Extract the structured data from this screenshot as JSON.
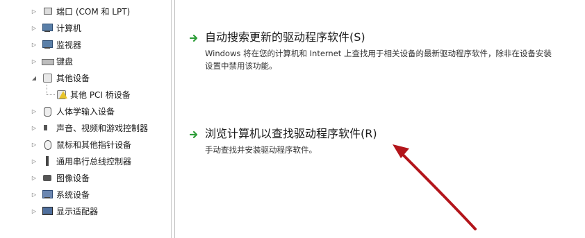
{
  "tree": {
    "items": [
      {
        "label": "端口 (COM 和 LPT)",
        "icon": "port-icon",
        "expander": "▷"
      },
      {
        "label": "计算机",
        "icon": "computer-icon",
        "expander": "▷"
      },
      {
        "label": "监视器",
        "icon": "monitor-icon",
        "expander": "▷"
      },
      {
        "label": "键盘",
        "icon": "keyboard-icon",
        "expander": "▷"
      },
      {
        "label": "其他设备",
        "icon": "other-devices-icon",
        "expander": "◢"
      },
      {
        "label": "其他 PCI 桥设备",
        "icon": "warning-device-icon",
        "expander": ""
      },
      {
        "label": "人体学输入设备",
        "icon": "hid-icon",
        "expander": "▷"
      },
      {
        "label": "声音、视频和游戏控制器",
        "icon": "speaker-icon",
        "expander": "▷"
      },
      {
        "label": "鼠标和其他指针设备",
        "icon": "mouse-icon",
        "expander": "▷"
      },
      {
        "label": "通用串行总线控制器",
        "icon": "usb-icon",
        "expander": "▷"
      },
      {
        "label": "图像设备",
        "icon": "camera-icon",
        "expander": "▷"
      },
      {
        "label": "系统设备",
        "icon": "system-devices-icon",
        "expander": "▷"
      },
      {
        "label": "显示适配器",
        "icon": "display-adapter-icon",
        "expander": "▷"
      }
    ]
  },
  "options": [
    {
      "title": "自动搜索更新的驱动程序软件(S)",
      "desc": "Windows 将在您的计算机和 Internet 上查找用于相关设备的最新驱动程序软件，除非在设备安装设置中禁用该功能。"
    },
    {
      "title": "浏览计算机以查找驱动程序软件(R)",
      "desc": "手动查找并安装驱动程序软件。"
    }
  ],
  "colors": {
    "arrow_green": "#2f9e3a",
    "annotation_red": "#b3151b"
  }
}
